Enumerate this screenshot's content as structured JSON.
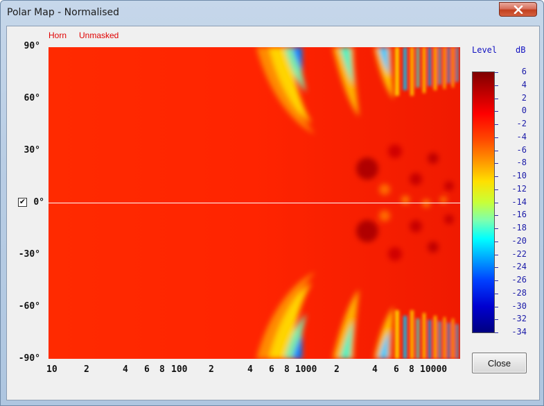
{
  "window": {
    "title": "Polar Map - Normalised"
  },
  "series_labels": [
    "Horn",
    "Unmasked"
  ],
  "zero_line_checkbox": {
    "checked": true,
    "mark": "✔"
  },
  "y_axis": {
    "ticks": [
      "90°",
      "60°",
      "30°",
      "0°",
      "-30°",
      "-60°",
      "-90°"
    ]
  },
  "x_axis": {
    "scale": "log",
    "ticks": [
      "10",
      "2",
      "4",
      "6",
      "8",
      "100",
      "2",
      "4",
      "6",
      "8",
      "1000",
      "2",
      "4",
      "6",
      "8",
      "10000"
    ]
  },
  "legend": {
    "title": "Level",
    "unit": "dB",
    "ticks": [
      "6",
      "4",
      "2",
      "0",
      "-2",
      "-4",
      "-6",
      "-8",
      "-10",
      "-12",
      "-14",
      "-16",
      "-18",
      "-20",
      "-22",
      "-24",
      "-26",
      "-28",
      "-30",
      "-32",
      "-34"
    ]
  },
  "buttons": {
    "close_label": "Close"
  },
  "chart_data": {
    "type": "heatmap",
    "x_scale": "log",
    "x_range": [
      10,
      20000
    ],
    "y_range": [
      -90,
      90
    ],
    "z_range": [
      -34,
      6
    ],
    "z_unit": "dB",
    "colormap": "jet",
    "reference_line_y": 0,
    "colors": {
      "background": "#ff2400",
      "series_label": "#e00000",
      "legend_text": "#1a1aa8"
    }
  }
}
